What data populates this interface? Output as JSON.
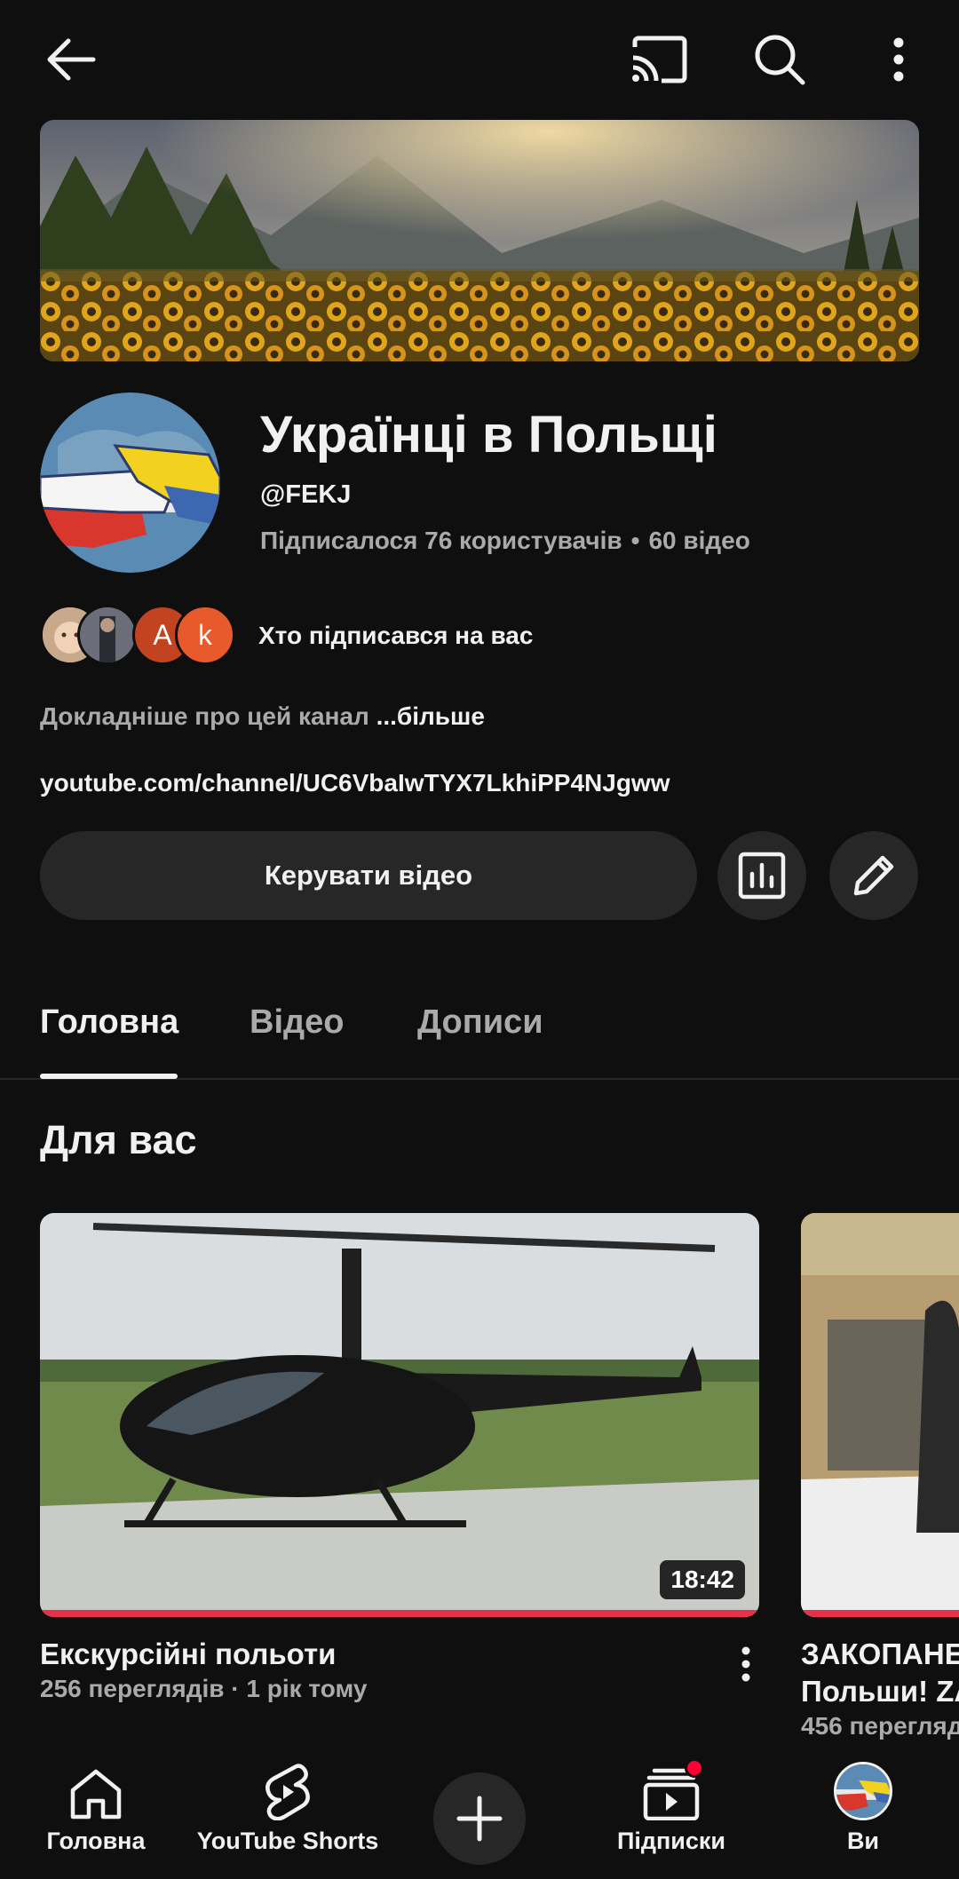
{
  "channel": {
    "title": "Українці в Польщі",
    "handle": "@FEKJ",
    "subscribers": "Підписалося 76 користувачів",
    "separator": "•",
    "video_count": "60 відео",
    "subscribers_link": "Хто підписався на вас",
    "mini_avatar_letters": [
      "A",
      "k"
    ],
    "about_text": "Докладніше про цей канал ",
    "about_more": "...більше",
    "link": "youtube.com/channel/UC6VbaIwTYX7LkhiPP4NJgww"
  },
  "actions": {
    "manage_label": "Керувати відео"
  },
  "tabs": [
    {
      "label": "Головна",
      "active": true
    },
    {
      "label": "Відео",
      "active": false
    },
    {
      "label": "Дописи",
      "active": false
    }
  ],
  "section": {
    "title": "Для вас"
  },
  "videos": [
    {
      "title": "Екскурсійні польоти",
      "meta": "256 переглядів · 1 рік тому",
      "duration": "18:42",
      "watched": 1.0
    },
    {
      "title": "ЗАКОПАНЕ",
      "title_line2": "Польши! ZA",
      "meta": "456 перегляд"
    }
  ],
  "bottom_nav": {
    "home": "Головна",
    "shorts": "YouTube Shorts",
    "subscriptions": "Підписки",
    "you": "Ви"
  },
  "colors": {
    "background": "#0f0f0f",
    "button_bg": "#272727",
    "secondary_text": "#aaaaaa",
    "progress": "#e8304a",
    "notification_dot": "#ff0033"
  }
}
